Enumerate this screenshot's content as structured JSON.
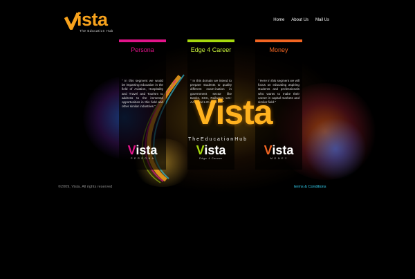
{
  "brand": {
    "name_prefix": "V",
    "name_suffix": "ista",
    "tagline": "The Education Hub"
  },
  "nav": {
    "items": [
      {
        "label": "Home"
      },
      {
        "label": "About Us"
      },
      {
        "label": "Mail Us"
      }
    ]
  },
  "panels": [
    {
      "title": "Persona",
      "accent": "#e2148a",
      "text": "\" In this segment we would be imparting education in the field of Aviation, Hospitality and Travel and Tourism to address to the immense opportunities in this field and other similar industries.\"",
      "mini_logo_sub": "P E R S O N A"
    },
    {
      "title": "Edge 4 Career",
      "accent": "#a6d80e",
      "text": "\" In this domain we intend to prepare students to quality different exam-ination in government sector like Banks, SSC, Railways, LIC- AAO and LIC-ADO etc.\"",
      "mini_logo_sub": "Edge 4 Career"
    },
    {
      "title": "Money",
      "accent": "#f26522",
      "text": "\" Here in this segment we will focus on educating aspiring students and professionals who wants to make their career in capital markets and similar field.\"",
      "mini_logo_sub": "M O N E Y"
    }
  ],
  "center_logo": {
    "word": "Vista",
    "sub": "TheEducationHub"
  },
  "footer": {
    "copyright": "©2009, Vista. All rights reserved",
    "terms": "terms & Conditions"
  },
  "colors": {
    "background": "#000000",
    "brand_orange": "#f7a21c",
    "terms_link": "#35d3f4"
  }
}
